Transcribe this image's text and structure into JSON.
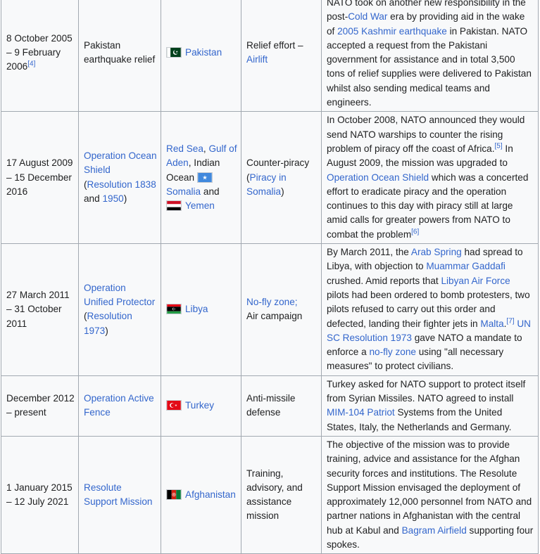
{
  "rows": [
    {
      "date": {
        "text": "8 October 2005 – 9 February 2006",
        "ref": "[4]"
      },
      "name": "Pakistan earthquake relief",
      "location": {
        "country": "Pakistan"
      },
      "type": {
        "prefix": "Relief effort – ",
        "link": "Airlift"
      },
      "description": {
        "p1": "NATO took on another new responsibility in the post-",
        "l1": "Cold War",
        "p2": " era by providing aid in the wake of ",
        "l2": "2005 Kashmir earthquake",
        "p3": " in Pakistan. NATO accepted a request from the Pakistani government for assistance and in total 3,500 tons of relief supplies were delivered to Pakistan whilst also sending medical teams and engineers."
      }
    },
    {
      "date": {
        "text": "17 August 2009 – 15 December 2016"
      },
      "name": {
        "l1": "Operation Ocean Shield",
        "open": " (",
        "l2": "Resolution 1838",
        "and": " and ",
        "l3": "1950",
        "close": ")"
      },
      "location": {
        "l1": "Red Sea",
        "sep": ", ",
        "l2": "Gulf of Aden",
        "rest": ", Indian Ocean ",
        "l3": "Somalia",
        "and": " and ",
        "l4": "Yemen"
      },
      "type": {
        "prefix": "Counter-piracy (",
        "link": "Piracy in Somalia",
        "suffix": ")"
      },
      "description": {
        "p1": "In October 2008, NATO announced they would send NATO warships to counter the rising problem of piracy off the coast of Africa.",
        "r1": "[5]",
        "p2": " In August 2009, the mission was upgraded to ",
        "l1": "Operation Ocean Shield",
        "p3": " which was a concerted effort to eradicate piracy and the operation continues to this day with piracy still at large amid calls for greater powers from NATO to combat the problem",
        "r2": "[6]"
      }
    },
    {
      "date": {
        "text": "27 March 2011 – 31 October 2011"
      },
      "name": {
        "l1": "Operation Unified Protector",
        "open": " (",
        "l2": "Resolution 1973",
        "close": ")"
      },
      "location": {
        "country": "Libya"
      },
      "type": {
        "link": "No-fly zone",
        "sep": ";",
        "rest": "Air campaign"
      },
      "description": {
        "p1": "By March 2011, the ",
        "l1": "Arab Spring",
        "p2": " had spread to Libya, with objection to ",
        "l2": "Muammar Gaddafi",
        "p3": " crushed. Amid reports that ",
        "l3": "Libyan Air Force",
        "p4": " pilots had been ordered to bomb protesters, two pilots refused to carry out this order and defected, landing their fighter jets in ",
        "l4": "Malta",
        "r1": "[7]",
        "p5": " ",
        "l5": "UN SC Resolution 1973",
        "p6": " gave NATO a mandate to enforce a ",
        "l6": "no-fly zone",
        "p7": " using \"all necessary measures\" to protect civilians."
      }
    },
    {
      "date": {
        "text": "December 2012 – present"
      },
      "name": {
        "l1": "Operation Active Fence"
      },
      "location": {
        "country": "Turkey"
      },
      "type": {
        "text": "Anti-missile defense"
      },
      "description": {
        "p1": "Turkey asked for NATO support to protect itself from Syrian Missiles. NATO agreed to install ",
        "l1": "MIM-104 Patriot",
        "p2": " Systems from the United States, Italy, the Netherlands and Germany."
      }
    },
    {
      "date": {
        "text": "1 January 2015 – 12 July 2021"
      },
      "name": {
        "l1": "Resolute Support Mission"
      },
      "location": {
        "country": "Afghanistan"
      },
      "type": {
        "text": "Training, advisory, and assistance mission"
      },
      "description": {
        "p1": "The objective of the mission was to provide training, advice and assistance for the Afghan security forces and institutions. The Resolute Support Mission envisaged the deployment of approximately 12,000 personnel from NATO and partner nations in Afghanistan with the central hub at Kabul and ",
        "l1": "Bagram Airfield",
        "p2": " supporting four spokes."
      }
    }
  ],
  "colors": {
    "link": "#3366cc",
    "border": "#a2a9b1",
    "background": "#f8f9fa",
    "text": "#202122"
  },
  "flags": [
    "pakistan-flag-icon",
    "somalia-flag-icon",
    "yemen-flag-icon",
    "libya-flag-icon",
    "turkey-flag-icon",
    "afghanistan-flag-icon"
  ]
}
